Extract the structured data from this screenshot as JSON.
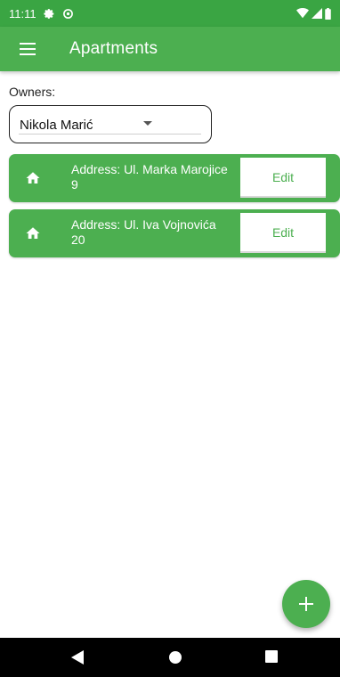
{
  "status_bar": {
    "time": "11:11",
    "left_icons": [
      "settings-gear-icon",
      "data-saver-icon"
    ],
    "right_icons": [
      "wifi-icon",
      "signal-icon",
      "battery-icon"
    ]
  },
  "app_bar": {
    "title": "Apartments",
    "menu_icon": "menu-icon"
  },
  "owners": {
    "label": "Owners:",
    "selected": "Nikola Marić"
  },
  "apartments": [
    {
      "icon": "home-icon",
      "address": "Address: Ul. Marka Marojice 9",
      "edit_label": "Edit"
    },
    {
      "icon": "home-icon",
      "address": "Address: Ul. Iva Vojnovića 20",
      "edit_label": "Edit"
    }
  ],
  "fab": {
    "icon": "add-icon",
    "label": "+"
  },
  "navigation": [
    "back-icon",
    "home-icon",
    "recents-icon"
  ],
  "colors": {
    "primary": "#4caf50",
    "status_bar": "#3aa543",
    "on_primary": "#ffffff",
    "nav_bar": "#000000"
  }
}
